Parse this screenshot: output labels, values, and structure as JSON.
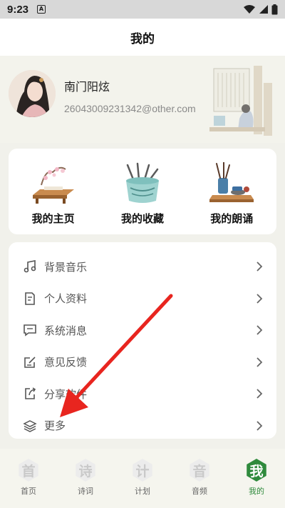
{
  "status_bar": {
    "time": "9:23",
    "notification_letter": "A"
  },
  "header": {
    "title": "我的"
  },
  "profile": {
    "name": "南门阳炫",
    "email": "26043009231342@other.com"
  },
  "quick_actions": [
    {
      "label": "我的主页",
      "icon": "desk-icon"
    },
    {
      "label": "我的收藏",
      "icon": "brush-pot-icon"
    },
    {
      "label": "我的朗诵",
      "icon": "inkstone-icon"
    }
  ],
  "menu": [
    {
      "label": "背景音乐",
      "icon": "music-note-icon"
    },
    {
      "label": "个人资料",
      "icon": "document-icon"
    },
    {
      "label": "系统消息",
      "icon": "message-icon"
    },
    {
      "label": "意见反馈",
      "icon": "feedback-icon"
    },
    {
      "label": "分享软件",
      "icon": "share-icon"
    },
    {
      "label": "更多",
      "icon": "layers-icon"
    }
  ],
  "bottom_nav": [
    {
      "glyph": "首",
      "label": "首页",
      "active": false
    },
    {
      "glyph": "诗",
      "label": "诗词",
      "active": false
    },
    {
      "glyph": "计",
      "label": "计划",
      "active": false
    },
    {
      "glyph": "音",
      "label": "音频",
      "active": false
    },
    {
      "glyph": "我",
      "label": "我的",
      "active": true
    }
  ],
  "colors": {
    "accent": "#2f8a3c",
    "arrow": "#e8251f",
    "background": "#f1f1eb"
  }
}
